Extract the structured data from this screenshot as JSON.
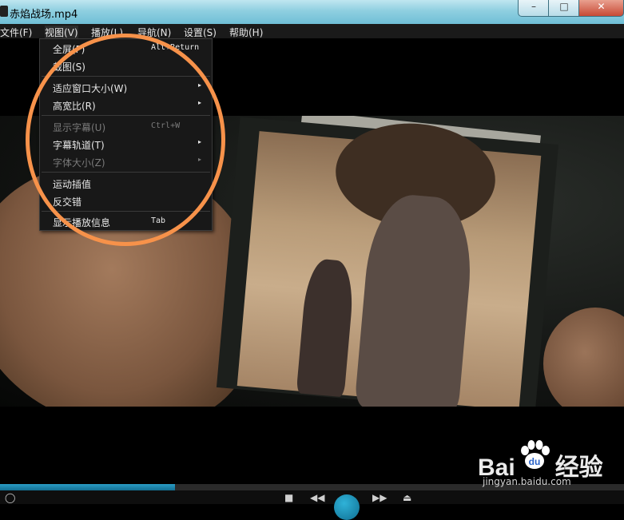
{
  "window": {
    "title": "赤焰战场.mp4",
    "controls": {
      "minimize": "–",
      "maximize": "□",
      "close": "✕"
    }
  },
  "menubar": {
    "items": [
      {
        "label": "文件(F)"
      },
      {
        "label": "视图(V)"
      },
      {
        "label": "播放(L)"
      },
      {
        "label": "导航(N)"
      },
      {
        "label": "设置(S)"
      },
      {
        "label": "帮助(H)"
      }
    ]
  },
  "view_menu": {
    "items": [
      {
        "label": "全屏(F)",
        "shortcut": "Alt+Return"
      },
      {
        "label": "截图(S)"
      },
      {
        "label": "适应窗口大小(W)",
        "submenu": "▸"
      },
      {
        "label": "高宽比(R)",
        "submenu": "▸"
      },
      {
        "label": "显示字幕(U)",
        "shortcut": "Ctrl+W",
        "disabled": true
      },
      {
        "label": "字幕轨道(T)",
        "submenu": "▸"
      },
      {
        "label": "字体大小(Z)",
        "submenu": "▸",
        "disabled": true
      },
      {
        "label": "运动插值"
      },
      {
        "label": "反交错"
      },
      {
        "label": "显示播放信息",
        "shortcut": "Tab"
      }
    ]
  },
  "playback": {
    "progress": 0.28
  },
  "watermark": {
    "brand_left": "Bai",
    "brand_right": "经验",
    "url": "jingyan.baidu.com"
  },
  "colors": {
    "accent": "#1e88b0",
    "annotation": "#f7924a"
  }
}
